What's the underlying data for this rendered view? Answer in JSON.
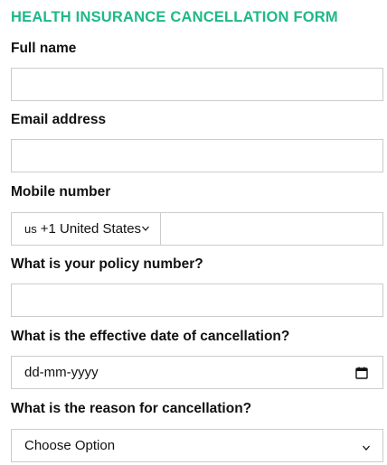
{
  "form": {
    "title": "HEALTH INSURANCE CANCELLATION FORM",
    "full_name": {
      "label": "Full name",
      "value": ""
    },
    "email": {
      "label": "Email address",
      "value": ""
    },
    "mobile": {
      "label": "Mobile number",
      "country_code": "us",
      "country_text": "+1 United States",
      "value": ""
    },
    "policy_number": {
      "label": "What is your policy number?",
      "value": ""
    },
    "effective_date": {
      "label": "What is the effective date of cancellation?",
      "placeholder": "dd-mm-yyyy"
    },
    "reason": {
      "label": "What is the reason for cancellation?",
      "selected": "Choose Option"
    }
  },
  "colors": {
    "title": "#1fb889",
    "text": "#111111",
    "border": "#cccccc",
    "background": "#ffffff"
  },
  "icons": {
    "country_dropdown": "chevron-down-icon",
    "date_picker": "calendar-icon",
    "reason_dropdown": "chevron-down-icon"
  }
}
